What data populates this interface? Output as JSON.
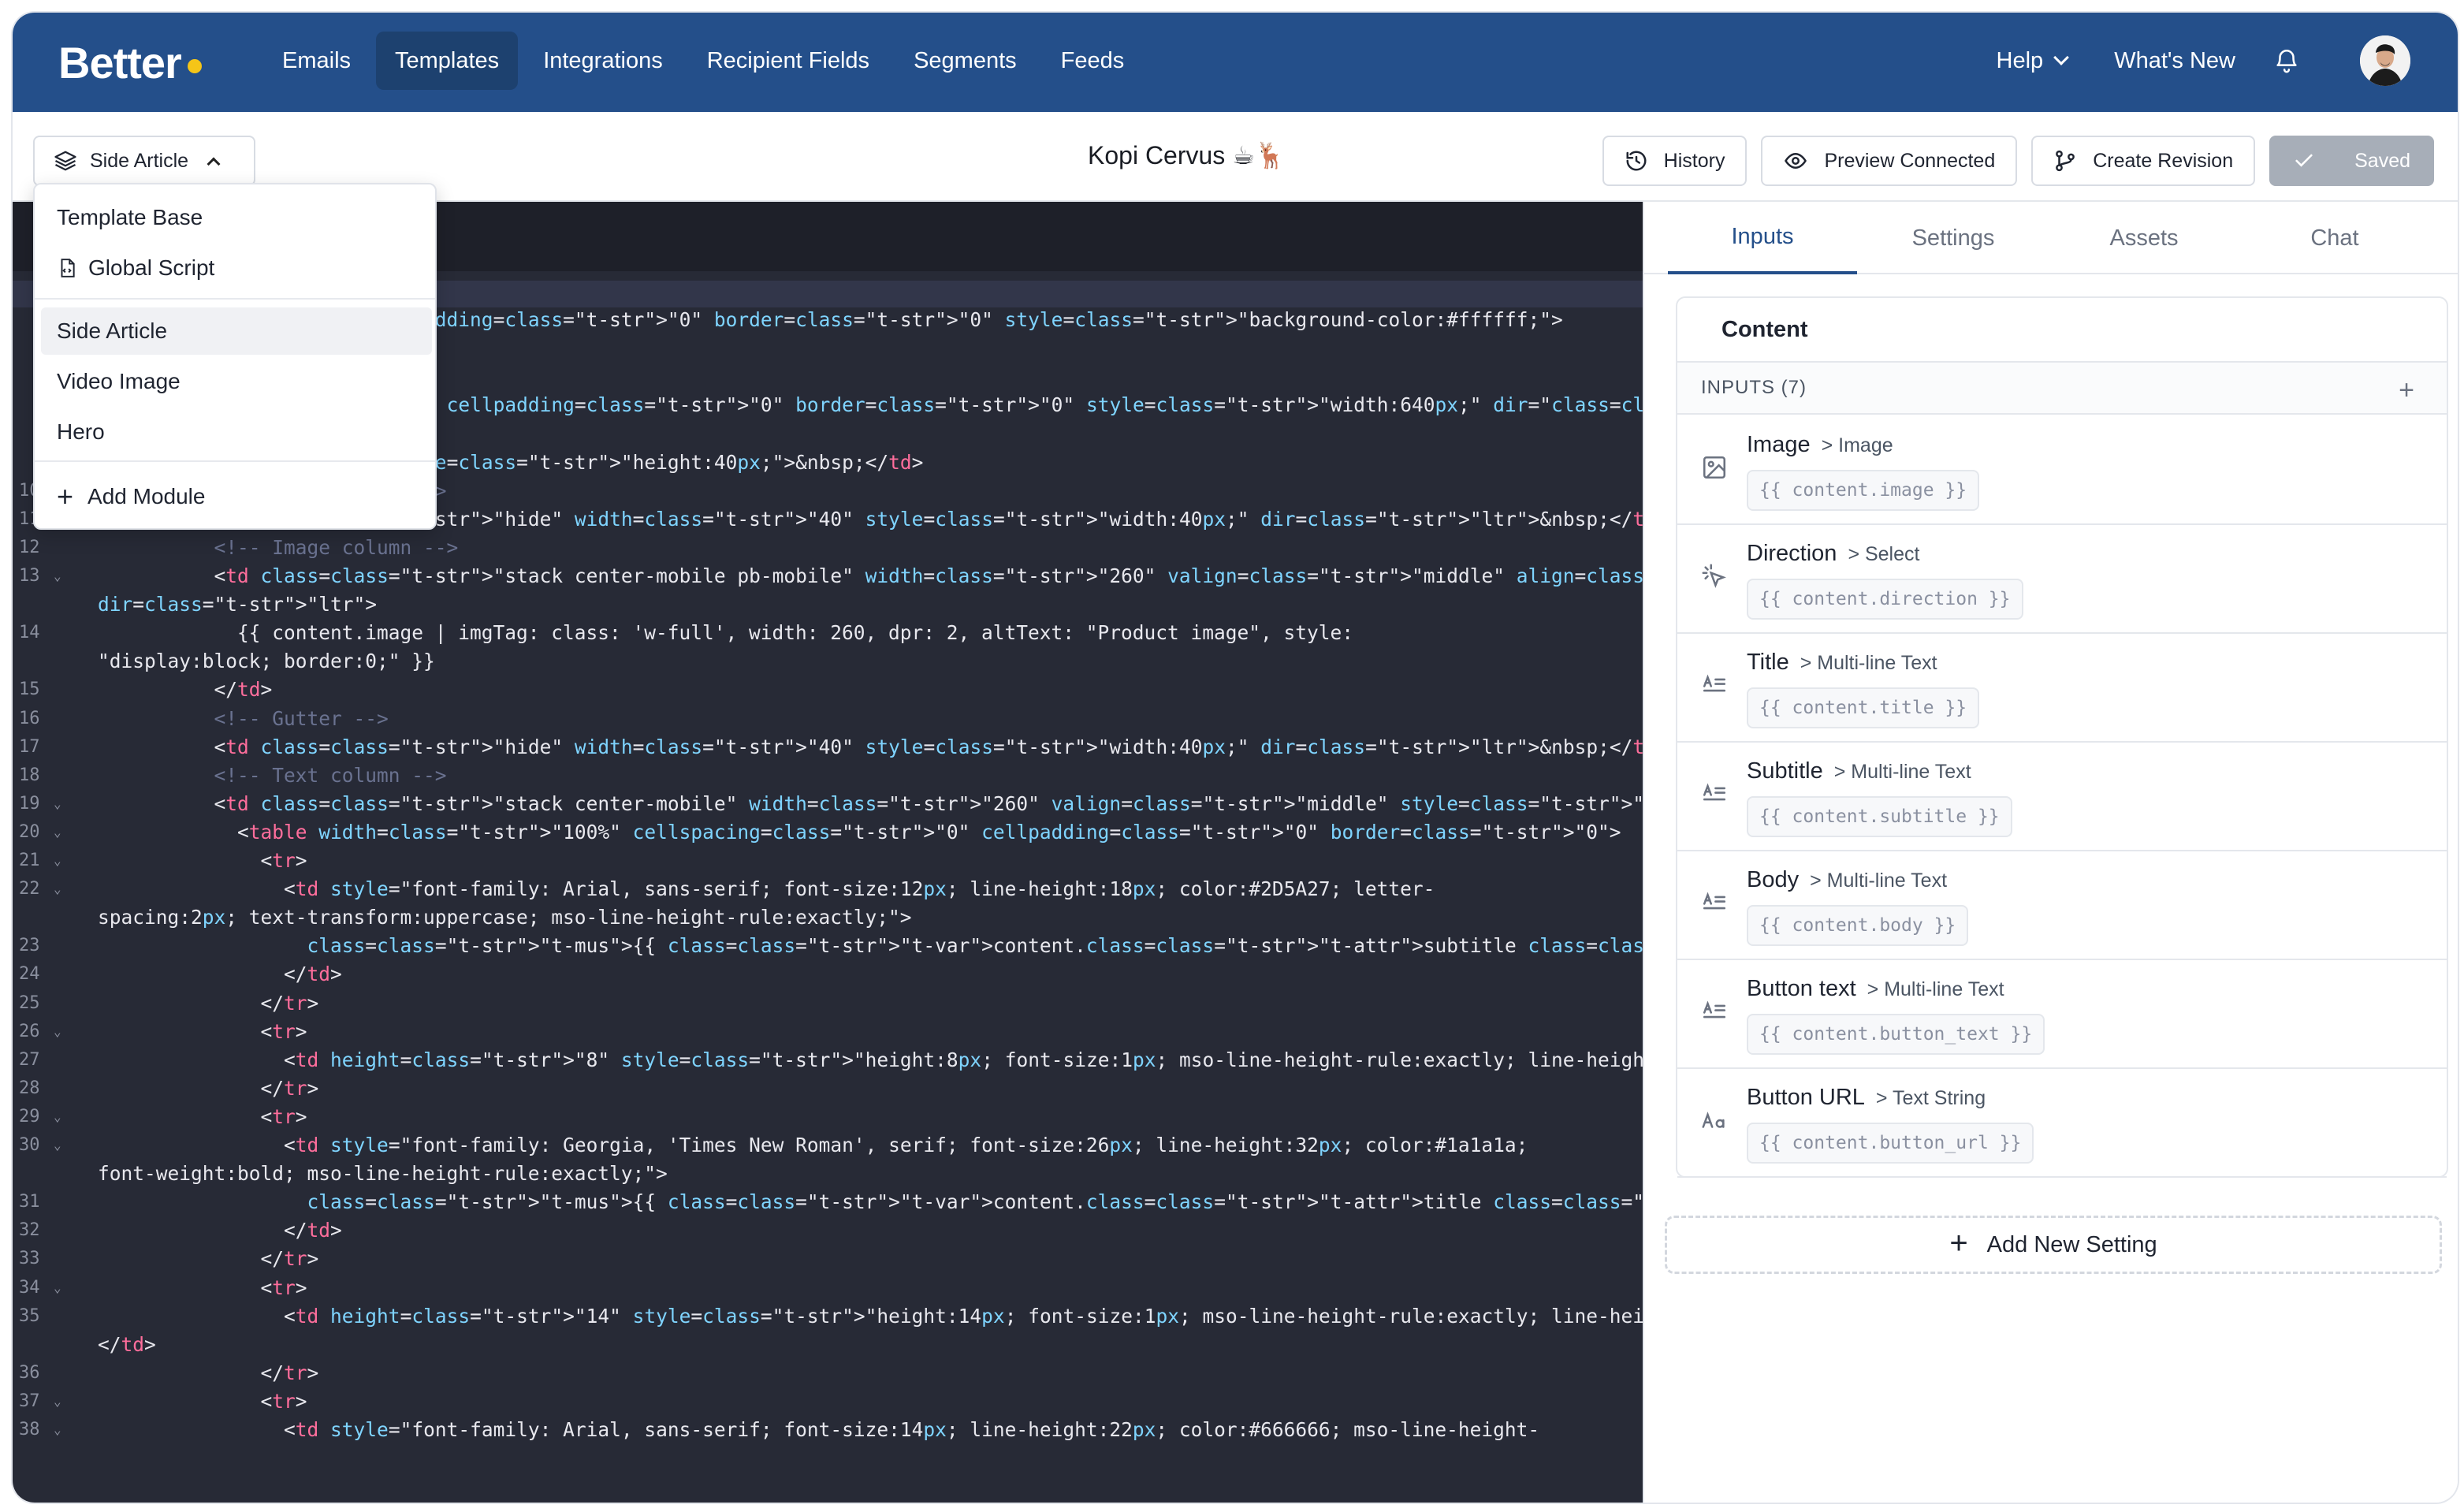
{
  "nav": {
    "logo": "Better",
    "links": [
      "Emails",
      "Templates",
      "Integrations",
      "Recipient Fields",
      "Segments",
      "Feeds"
    ],
    "active_index": 1,
    "help": "Help",
    "whats_new": "What's New"
  },
  "toolbar": {
    "module_select": "Side Article",
    "title": "Kopi Cervus ☕🦌",
    "history": "History",
    "preview": "Preview Connected",
    "revision": "Create Revision",
    "saved": "Saved"
  },
  "dropdown": {
    "items": [
      "Template Base",
      "Global Script",
      "Side Article",
      "Video Image",
      "Hero",
      "Add Module"
    ],
    "active": "Side Article"
  },
  "panel": {
    "tabs": [
      "Inputs",
      "Settings",
      "Assets",
      "Chat"
    ],
    "active_tab": "Inputs",
    "card_title": "Content",
    "inputs_header": "INPUTS (7)",
    "inputs": [
      {
        "name": "Image",
        "type": "> Image",
        "var": "{{ content.image }}",
        "icon": "image-icon"
      },
      {
        "name": "Direction",
        "type": "> Select",
        "var": "{{ content.direction }}",
        "icon": "cursor-click-icon"
      },
      {
        "name": "Title",
        "type": "> Multi-line Text",
        "var": "{{ content.title }}",
        "icon": "text-lines-icon"
      },
      {
        "name": "Subtitle",
        "type": "> Multi-line Text",
        "var": "{{ content.subtitle }}",
        "icon": "text-lines-icon"
      },
      {
        "name": "Body",
        "type": "> Multi-line Text",
        "var": "{{ content.body }}",
        "icon": "text-lines-icon"
      },
      {
        "name": "Button text",
        "type": "> Multi-line Text",
        "var": "{{ content.button_text }}",
        "icon": "text-lines-icon"
      },
      {
        "name": "Button URL",
        "type": "> Text String",
        "var": "{{ content.button_url }}",
        "icon": "text-string-icon"
      }
    ],
    "add_setting": "Add New Setting"
  },
  "code": {
    "lines": [
      {
        "n": "",
        "t": "<!-- --> ",
        "frag": true
      },
      {
        "n": "",
        "t": "cing=\"0\" cellpadding=\"0\" border=\"0\" style=\"background-color:#ffffff;\">"
      },
      {
        "n": "",
        "t": ""
      },
      {
        "n": "",
        "t": ""
      },
      {
        "n": "",
        "t": "cellspacing=\"0\" cellpadding=\"0\" border=\"0\" style=\"width:640px;\" dir=\"{{ content.direction }}\">"
      },
      {
        "n": "",
        "t": ""
      },
      {
        "n": "",
        "t": "eight=\"40\" style=\"height:40px;\">&nbsp;</td>"
      },
      {
        "n": "10",
        "t": "          <!-- Left spacer -->"
      },
      {
        "n": "11",
        "t": "          <td class=\"hide\" width=\"40\" style=\"width:40px;\" dir=\"ltr\">&nbsp;</td>"
      },
      {
        "n": "12",
        "t": "          <!-- Image column -->"
      },
      {
        "n": "13",
        "t": "          <td class=\"stack center-mobile pb-mobile\" width=\"260\" valign=\"middle\" align=\"center\" style=\"width:260px;\""
      },
      {
        "n": "",
        "t": "dir=\"ltr\">"
      },
      {
        "n": "14",
        "t": "            {{ content.image | imgTag: class: 'w-full', width: 260, dpr: 2, altText: \"Product image\", style:"
      },
      {
        "n": "",
        "t": "\"display:block; border:0;\" }}"
      },
      {
        "n": "15",
        "t": "          </td>"
      },
      {
        "n": "16",
        "t": "          <!-- Gutter -->"
      },
      {
        "n": "17",
        "t": "          <td class=\"hide\" width=\"40\" style=\"width:40px;\" dir=\"ltr\">&nbsp;</td>"
      },
      {
        "n": "18",
        "t": "          <!-- Text column -->"
      },
      {
        "n": "19",
        "t": "          <td class=\"stack center-mobile\" width=\"260\" valign=\"middle\" style=\"width:260px;\" dir=\"ltr\">"
      },
      {
        "n": "20",
        "t": "            <table width=\"100%\" cellspacing=\"0\" cellpadding=\"0\" border=\"0\">"
      },
      {
        "n": "21",
        "t": "              <tr>"
      },
      {
        "n": "22",
        "t": "                <td style=\"font-family: Arial, sans-serif; font-size:12px; line-height:18px; color:#2D5A27; letter-"
      },
      {
        "n": "",
        "t": "spacing:2px; text-transform:uppercase; mso-line-height-rule:exactly;\">"
      },
      {
        "n": "23",
        "t": "                  {{ content.subtitle }}"
      },
      {
        "n": "24",
        "t": "                </td>"
      },
      {
        "n": "25",
        "t": "              </tr>"
      },
      {
        "n": "26",
        "t": "              <tr>"
      },
      {
        "n": "27",
        "t": "                <td height=\"8\" style=\"height:8px; font-size:1px; mso-line-height-rule:exactly; line-height:1px;\">&nbsp;</td>"
      },
      {
        "n": "28",
        "t": "              </tr>"
      },
      {
        "n": "29",
        "t": "              <tr>"
      },
      {
        "n": "30",
        "t": "                <td style=\"font-family: Georgia, 'Times New Roman', serif; font-size:26px; line-height:32px; color:#1a1a1a;"
      },
      {
        "n": "",
        "t": "font-weight:bold; mso-line-height-rule:exactly;\">"
      },
      {
        "n": "31",
        "t": "                  {{ content.title }}"
      },
      {
        "n": "32",
        "t": "                </td>"
      },
      {
        "n": "33",
        "t": "              </tr>"
      },
      {
        "n": "34",
        "t": "              <tr>"
      },
      {
        "n": "35",
        "t": "                <td height=\"14\" style=\"height:14px; font-size:1px; mso-line-height-rule:exactly; line-height:1px;\">&nbsp;"
      },
      {
        "n": "",
        "t": "</td>"
      },
      {
        "n": "36",
        "t": "              </tr>"
      },
      {
        "n": "37",
        "t": "              <tr>"
      },
      {
        "n": "38",
        "t": "                <td style=\"font-family: Arial, sans-serif; font-size:14px; line-height:22px; color:#666666; mso-line-height-"
      }
    ]
  }
}
